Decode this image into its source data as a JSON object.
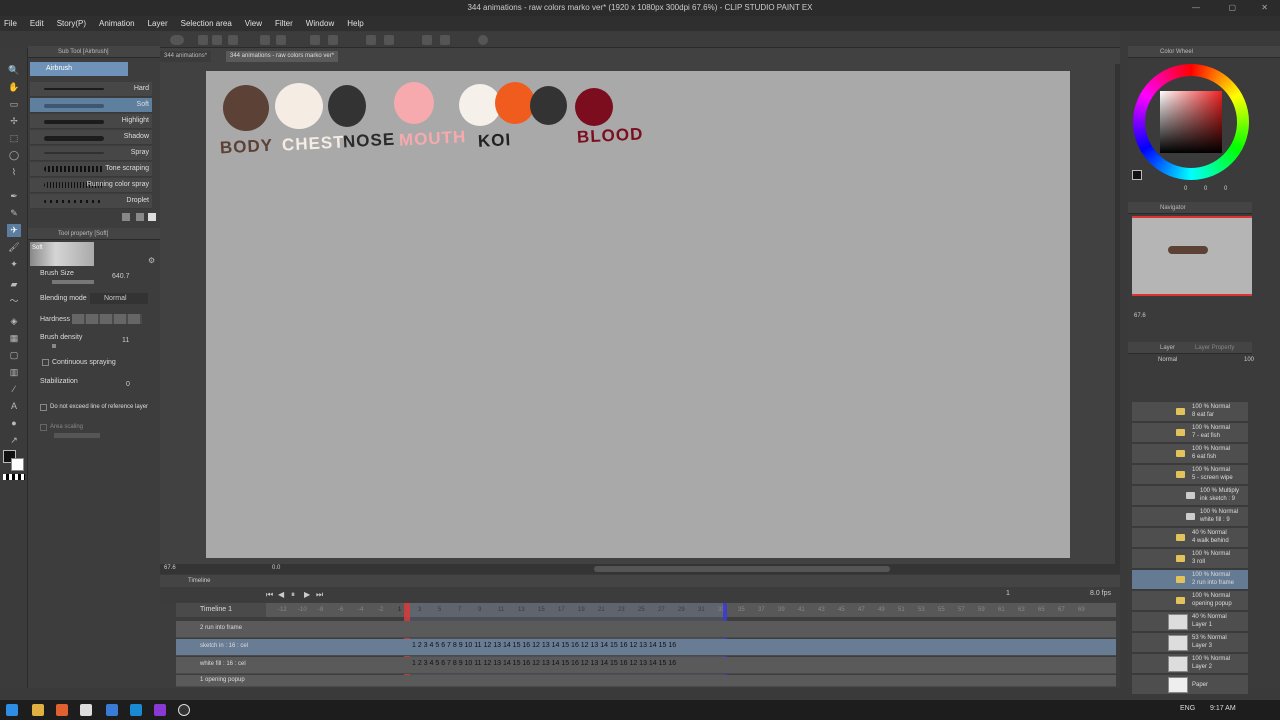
{
  "window": {
    "title": "344 animations - raw colors marko ver* (1920 x 1080px 300dpi 67.6%) - CLIP STUDIO PAINT EX"
  },
  "menu": [
    "File",
    "Edit",
    "Story(P)",
    "Animation",
    "Layer",
    "Selection area",
    "View",
    "Filter",
    "Window",
    "Help"
  ],
  "doc_tabs": [
    "344 animations*",
    "344 animations - raw colors marko ver*"
  ],
  "subtool": {
    "header": "Sub Tool [Airbrush]",
    "group": "Airbrush",
    "brushes": [
      "Hard",
      "Soft",
      "Highlight",
      "Shadow",
      "Spray",
      "Tone scraping",
      "Running color spray",
      "Droplet"
    ],
    "selected": "Soft"
  },
  "toolprop": {
    "header": "Tool property [Soft]",
    "preview_label": "Soft",
    "brush_size_label": "Brush Size",
    "brush_size_value": "640.7",
    "blending_label": "Blending mode",
    "blending_value": "Normal",
    "hardness_label": "Hardness",
    "density_label": "Brush density",
    "density_value": "11",
    "continuous_label": "Continuous spraying",
    "stabilization_label": "Stabilization",
    "stabilization_value": "0",
    "reference_label": "Do not exceed line of reference layer",
    "area_label": "Area scaling"
  },
  "swatches": [
    {
      "label": "BODY",
      "color": "#5b4136",
      "label_color": "#5b4136"
    },
    {
      "label": "CHEST",
      "color": "#f5ece4",
      "label_color": "#f5ece4"
    },
    {
      "label": "NOSE",
      "color": "#333333",
      "label_color": "#2a2a2a"
    },
    {
      "label": "MOUTH",
      "color": "#f7aaae",
      "label_color": "#f7aaae"
    },
    {
      "label": "KOI",
      "color": "#f6f0ea",
      "label_color": "#222222"
    },
    {
      "label": "BLOOD",
      "color": "#7b0d1e",
      "label_color": "#7b0d1e"
    }
  ],
  "koi_extra_colors": [
    "#ef5c1d",
    "#333333"
  ],
  "status": {
    "zoom": "67.6",
    "angle": "0.0"
  },
  "timeline": {
    "header": "Timeline",
    "name": "Timeline 1",
    "current_frame": "1",
    "fps": "8.0 fps",
    "ruler_neg": [
      "-12",
      "-10",
      "-8",
      "-6",
      "-4",
      "-2"
    ],
    "ruler_pos": [
      "1",
      "3",
      "5",
      "7",
      "9",
      "11",
      "13",
      "15",
      "17",
      "19",
      "21",
      "23",
      "25",
      "27",
      "29",
      "31"
    ],
    "ruler_after": [
      "33",
      "35",
      "37",
      "39",
      "41",
      "43",
      "45",
      "47",
      "49",
      "51",
      "53",
      "55",
      "57",
      "59",
      "61",
      "63",
      "65",
      "67",
      "69"
    ],
    "tracks": [
      {
        "name": "2 run into frame",
        "cells": ""
      },
      {
        "name": "sketch in : 16 : cel",
        "cells": "1 2 3 4 5 6 7 8 9 10 11 12 13 14 15 16 12 13 14 15 16 12 13 14 15 16 12 13 14 15 16"
      },
      {
        "name": "white fill : 16 : cel",
        "cells": "1 2 3 4 5 6 7 8 9 10 11 12 13 14 15 16 12 13 14 15 16 12 13 14 15 16 12 13 14 15 16"
      },
      {
        "name": "1 opening popup",
        "cells": ""
      }
    ]
  },
  "color_panel": {
    "header": "Color Wheel",
    "values": [
      "0",
      "0",
      "0"
    ]
  },
  "navigator": {
    "header": "Navigator",
    "zoom": "67.6"
  },
  "layer_panel": {
    "header": "Layer",
    "header2": "Layer Property",
    "blend": "Normal",
    "opacity": "100",
    "layers": [
      {
        "line1": "100 % Normal",
        "line2": "8 eat far",
        "type": "folder"
      },
      {
        "line1": "100 % Normal",
        "line2": "7 - eat fish",
        "type": "folder"
      },
      {
        "line1": "100 % Normal",
        "line2": "6 eat fish",
        "type": "folder"
      },
      {
        "line1": "100 % Normal",
        "line2": "5 - screen wipe",
        "type": "folder"
      },
      {
        "line1": "100 % Multiply",
        "line2": "ink sketch : 9",
        "type": "anim"
      },
      {
        "line1": "100 % Normal",
        "line2": "white fill : 9",
        "type": "anim"
      },
      {
        "line1": "40 % Normal",
        "line2": "4 walk behind",
        "type": "folder"
      },
      {
        "line1": "100 % Normal",
        "line2": "3 roll",
        "type": "folder"
      },
      {
        "line1": "100 % Normal",
        "line2": "2 run into frame",
        "type": "folder"
      },
      {
        "line1": "100 % Normal",
        "line2": "opening popup",
        "type": "folder"
      },
      {
        "line1": "40 % Normal",
        "line2": "Layer 1",
        "type": "raster"
      },
      {
        "line1": "53 % Normal",
        "line2": "Layer 3",
        "type": "raster"
      },
      {
        "line1": "100 % Normal",
        "line2": "Layer 2",
        "type": "raster"
      },
      {
        "line1": "",
        "line2": "Paper",
        "type": "paper"
      }
    ]
  },
  "taskbar": {
    "lang": "ENG",
    "time": "9:17 AM"
  }
}
